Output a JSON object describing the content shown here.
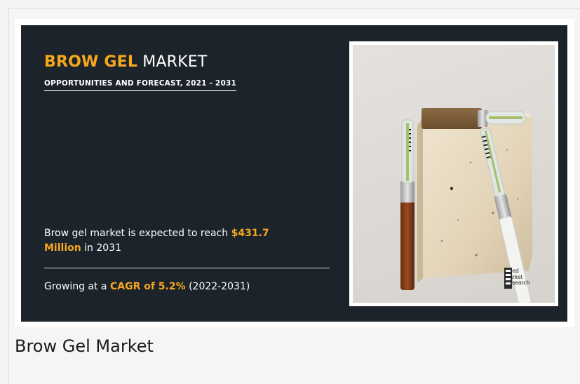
{
  "banner": {
    "title_highlight": "BROW GEL",
    "title_rest": " MARKET",
    "subtitle": "OPPORTUNITIES AND FORECAST, 2021 - 2031",
    "stat1": {
      "prefix": "Brow gel market is expected to reach ",
      "value": "$431.7 Million",
      "suffix": " in 2031"
    },
    "stat2": {
      "prefix": "Growing at a ",
      "value": "CAGR of 5.2%",
      "suffix": " (2022-2031)"
    },
    "logo": {
      "line1": "Allied",
      "line2": "Market",
      "line3": "Research"
    }
  },
  "caption": "Brow Gel Market",
  "colors": {
    "banner_bg": "#1c232b",
    "accent": "#f6a81c",
    "text": "#ffffff"
  }
}
